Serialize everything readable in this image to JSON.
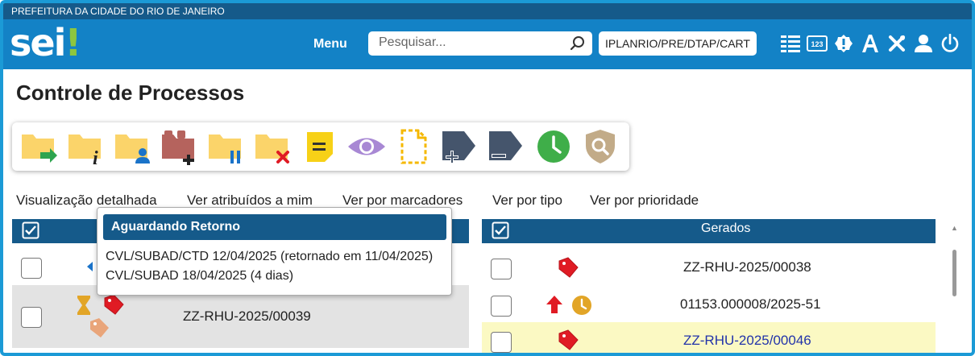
{
  "gov_bar": {
    "text": "PREFEITURA DA CIDADE DO RIO DE JANEIRO"
  },
  "header": {
    "logo": "sei",
    "logo_bang": "!",
    "menu_label": "Menu",
    "search_placeholder": "Pesquisar...",
    "unit": "IPLANRIO/PRE/DTAP/CART",
    "icons": [
      "list-icon",
      "numbers-icon",
      "alert-badge-icon",
      "font-size-icon",
      "tools-icon",
      "user-icon",
      "power-icon"
    ]
  },
  "page_title": "Controle de Processos",
  "toolbar": {
    "buttons": [
      "folder-send-icon",
      "folder-info-icon",
      "folder-user-icon",
      "folder-add-icon",
      "folder-pause-icon",
      "folder-cancel-icon",
      "note-icon",
      "eye-icon",
      "dashed-document-icon",
      "tag-add-icon",
      "tag-remove-icon",
      "clock-icon",
      "shield-search-icon"
    ]
  },
  "views": [
    "Visualização detalhada",
    "Ver atribuídos a mim",
    "Ver por marcadores",
    "Ver por tipo",
    "Ver por prioridade"
  ],
  "left_table": {
    "rows": [
      {
        "process": ""
      },
      {
        "process": "ZZ-RHU-2025/00039"
      }
    ]
  },
  "right_table": {
    "header": "Gerados",
    "rows": [
      {
        "process": "ZZ-RHU-2025/00038"
      },
      {
        "process": "01153.000008/2025-51"
      },
      {
        "process": "ZZ-RHU-2025/00046"
      }
    ]
  },
  "tooltip": {
    "title": "Aguardando Retorno",
    "lines": [
      "CVL/SUBAD/CTD 12/04/2025 (retornado em 11/04/2025)",
      "CVL/SUBAD 18/04/2025 (4 dias)"
    ]
  },
  "colors": {
    "gov_bar": "#155a8a",
    "header": "#1382c6",
    "accent_green": "#8dc63f",
    "highlight_row": "#fbf9c3",
    "selected_row": "#e3e3e3",
    "tag_red": "#e01b24"
  }
}
